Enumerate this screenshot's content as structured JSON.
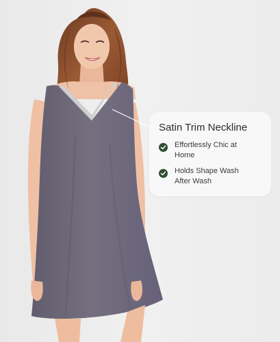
{
  "callout": {
    "title": "Satin Trim Neckline",
    "features": [
      {
        "text": "Effortlessly Chic at Home",
        "icon": "check-circle-icon"
      },
      {
        "text": "Holds Shape Wash After Wash",
        "icon": "check-circle-icon"
      }
    ]
  },
  "colors": {
    "background": "#ededed",
    "dress": "#6f6a7b",
    "satin_trim": "#c9c9c9",
    "hair": "#8a4a2a",
    "skin": "#f0c4a8",
    "check": "#2e4f31"
  }
}
